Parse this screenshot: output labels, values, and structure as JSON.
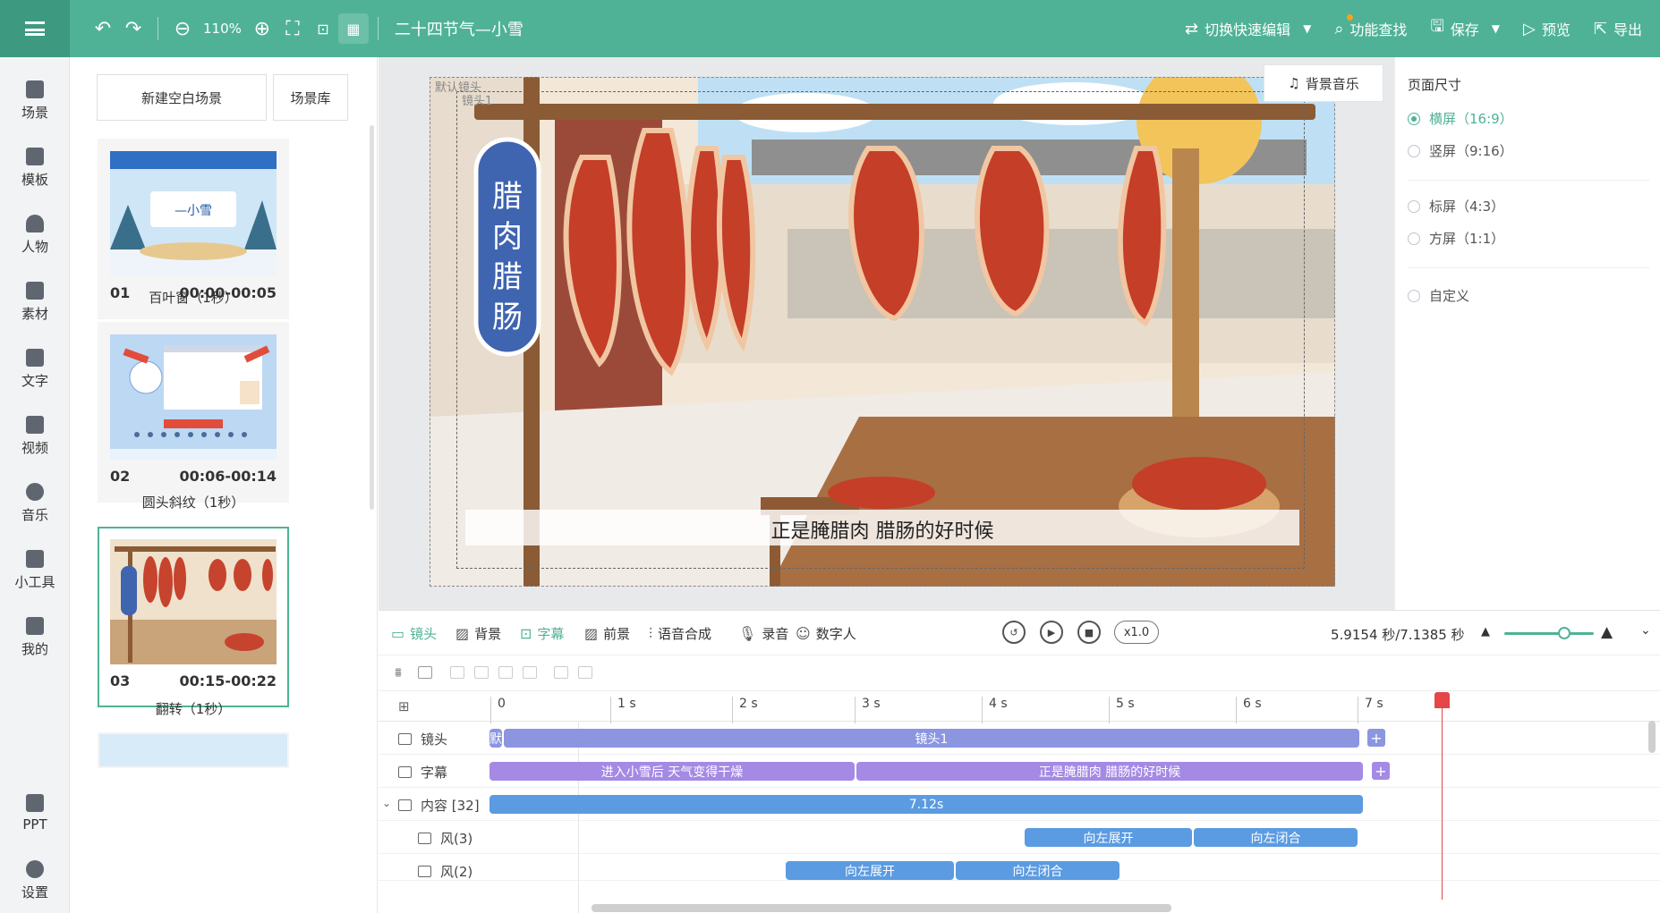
{
  "topbar": {
    "zoom": "110%",
    "doc_title": "二十四节气—小雪",
    "switch_edit": "切换快速编辑",
    "find": "功能查找",
    "save": "保存",
    "preview": "预览",
    "export": "导出"
  },
  "rail": {
    "items": [
      "场景",
      "模板",
      "人物",
      "素材",
      "文字",
      "视频",
      "音乐",
      "小工具",
      "我的"
    ],
    "ppt": "PPT",
    "settings": "设置"
  },
  "scenes": {
    "new_blank": "新建空白场景",
    "library": "场景库",
    "cards": [
      {
        "num": "01",
        "time": "00:00-00:05",
        "transition": "百叶窗（1秒）"
      },
      {
        "num": "02",
        "time": "00:06-00:14",
        "transition": "圆头斜纹（1秒）"
      },
      {
        "num": "03",
        "time": "00:15-00:22",
        "transition": "翻转（1秒）"
      }
    ]
  },
  "stage": {
    "default_cam": "默认镜头",
    "cam1": "镜头1",
    "sign_text": "腊肉腊肠",
    "subtitle": "正是腌腊肉 腊肠的好时候",
    "bgm": "背景音乐"
  },
  "page_size": {
    "title": "页面尺寸",
    "options": [
      "横屏（16:9）",
      "竖屏（9:16）",
      "标屏（4:3）",
      "方屏（1:1）",
      "自定义"
    ],
    "selected": "横屏（16:9）"
  },
  "timeline": {
    "tabs": [
      "镜头",
      "背景",
      "字幕",
      "前景",
      "语音合成",
      "录音",
      "数字人"
    ],
    "speed": "x1.0",
    "time": "5.9154 秒/7.1385 秒",
    "ruler": [
      "0",
      "1 s",
      "2 s",
      "3 s",
      "4 s",
      "5 s",
      "6 s",
      "7 s"
    ],
    "rows": {
      "camera": {
        "label": "镜头",
        "clip_default": "默",
        "clip": "镜头1"
      },
      "subtitle": {
        "label": "字幕",
        "clips": [
          "进入小雪后 天气变得干燥",
          "正是腌腊肉 腊肠的好时候"
        ]
      },
      "content": {
        "label": "内容 [32]",
        "clip": "7.12s"
      },
      "wind3": {
        "label": "风(3)",
        "clips": [
          "向左展开",
          "向左闭合"
        ]
      },
      "wind2": {
        "label": "风(2)",
        "clips": [
          "向左展开",
          "向左闭合"
        ]
      }
    }
  },
  "colors": {
    "accent": "#4fb296",
    "playhead": "#e54646"
  }
}
